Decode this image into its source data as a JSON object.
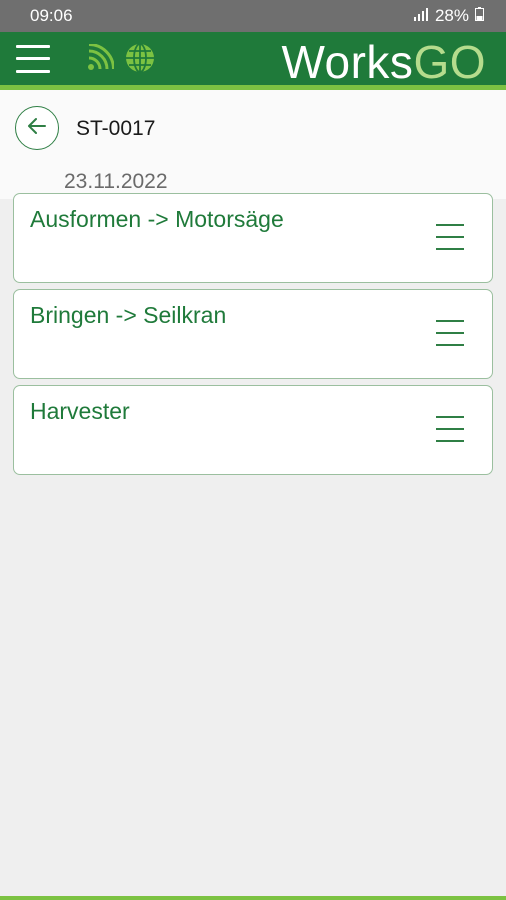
{
  "status": {
    "time": "09:06",
    "battery": "28%",
    "signal_icon": "signal-icon",
    "battery_icon": "battery-icon"
  },
  "appbar": {
    "brand_main": "Works",
    "brand_accent": "GO",
    "menu_icon": "menu-icon",
    "wifi_icon": "wifi-icon",
    "globe_icon": "globe-icon"
  },
  "header": {
    "title": "ST-0017",
    "date": "23.11.2022",
    "back_icon": "back-arrow-icon"
  },
  "items": [
    {
      "label": "Ausformen -> Motorsäge"
    },
    {
      "label": "Bringen -> Seilkran"
    },
    {
      "label": "Harvester"
    }
  ],
  "colors": {
    "primary": "#1f7a3a",
    "accent": "#7cc242",
    "status_bar": "#6f6f6f"
  }
}
